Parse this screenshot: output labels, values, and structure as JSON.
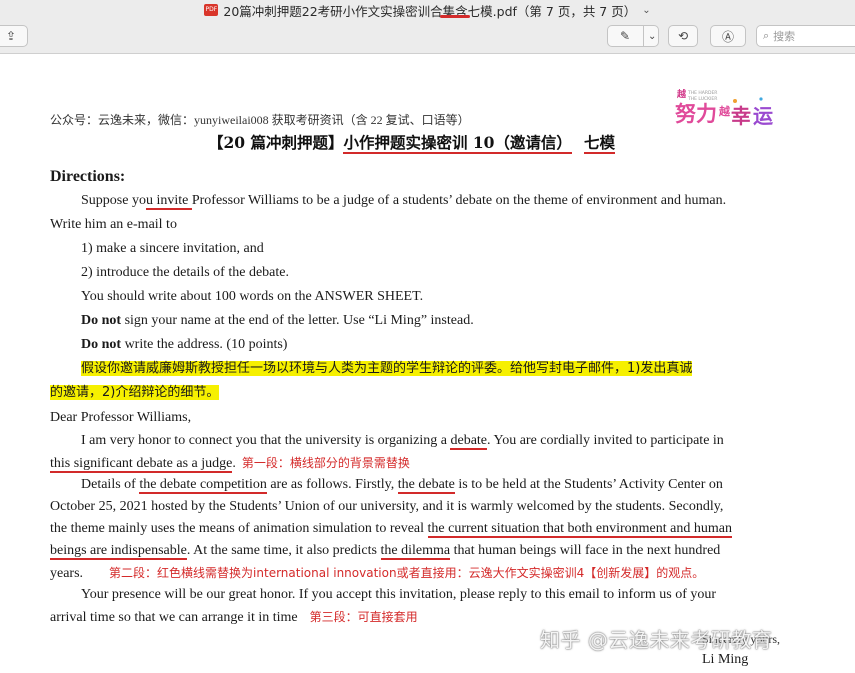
{
  "window": {
    "title": "20篇冲刺押题22考研小作文实操密训合集含七模.pdf（第 7 页，共 7 页）",
    "title_chevron": "⌄"
  },
  "toolbar": {
    "share_icon": "⇪",
    "markup_icon": "✎",
    "markup_chevron": "⌄",
    "rotate_icon": "⟲",
    "annotate_icon": "Ⓐ",
    "search_placeholder": "搜索"
  },
  "doc": {
    "header": "公众号：云逸未来，微信：yunyiweilai008 获取考研资讯（含 22 复试、口语等）",
    "title_part1": "【20 篇冲刺押题】",
    "title_part2": "小作押题实操密训 10（邀请信）",
    "title_part3": "七模",
    "directions": "Directions:",
    "dir_line1_a": "Suppose yo",
    "dir_line1_b": "u invite ",
    "dir_line1_c": "Professor Williams to be a judge of a students’ debate on the theme of environment and human.",
    "dir_line2": "Write him an e-mail to",
    "dir_item1": "1) make a sincere invitation, and",
    "dir_item2": "2) introduce the details of the debate.",
    "dir_words": "You should write about 100 words on the ANSWER SHEET.",
    "dir_do_not1": "Do not",
    "dir_sign": " sign your name at the end of the letter. Use “Li Ming” instead.",
    "dir_do_not2": "Do not",
    "dir_address": " write the address. (10 points)",
    "zh_line1": "假设你邀请威廉姆斯教授担任一场以环境与人类为主题的学生辩论的评委。给他写封电子邮件，1)发出真诚",
    "zh_line2": "的邀请，2)介绍辩论的细节。",
    "salutation": "Dear Professor Williams,",
    "p1_a": "I am very honor to connect you that the university is organizing a ",
    "p1_b": "debate",
    "p1_c": ". You are cordially invited to participate in",
    "p1_d": "this significant debate as a judge",
    "p1_e": ".",
    "note1": "第一段：横线部分的背景需替换",
    "p2_a": "Details of ",
    "p2_b": "the debate competition",
    "p2_c": " are as follows. Firstly, ",
    "p2_d": "the debate",
    "p2_e": " is to be held at the Students’ Activity Center on",
    "p2_line2": "October 25, 2021 hosted by the Students’ Union of our university, and it is warmly welcomed by the students. Secondly,",
    "p2_line3_a": "the theme mainly uses the means of animation simulation to reveal ",
    "p2_line3_b": "the current situation that both environment and human",
    "p2_line4_a": "beings are indispensable",
    "p2_line4_b": ". At the same time, it also predicts ",
    "p2_line4_c": "the dilemma",
    "p2_line4_d": " that human beings will face in the next hundred",
    "p2_line5": "years.",
    "note2": "第二段：红色横线需替换为international innovation或者直接用：云逸大作文实操密训4【创新发展】的观点。",
    "p3_line1": "Your presence will be our great honor. If you accept this invitation, please reply to this email to inform us of your",
    "p3_line2": "arrival time so that we can arrange it in time",
    "note3": "第三段：可直接套用",
    "closing": "Sincerely yours,",
    "signature": "Li Ming"
  },
  "watermark": "知乎 @云逸未来考研教育",
  "colors": {
    "highlight": "#f6f000",
    "red_ink": "#d22a2a"
  }
}
